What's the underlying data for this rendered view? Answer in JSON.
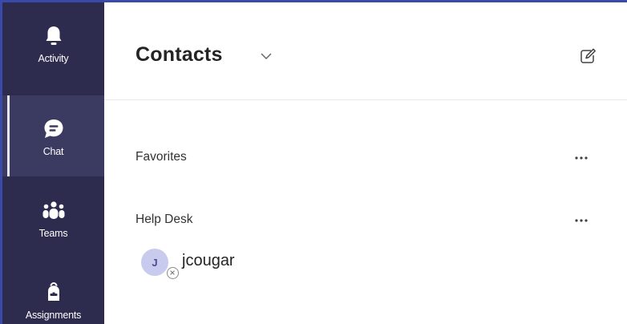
{
  "rail": {
    "items": [
      {
        "label": "Activity",
        "icon": "bell-icon"
      },
      {
        "label": "Chat",
        "icon": "chat-icon"
      },
      {
        "label": "Teams",
        "icon": "teams-icon"
      },
      {
        "label": "Assignments",
        "icon": "backpack-icon"
      }
    ],
    "active": "Chat"
  },
  "header": {
    "title": "Contacts"
  },
  "groups": [
    {
      "label": "Favorites"
    },
    {
      "label": "Help Desk"
    }
  ],
  "contacts": [
    {
      "initial": "J",
      "name": "jcougar",
      "presence_icon": "offline-icon"
    }
  ],
  "colors": {
    "rail_bg": "#2d2c4e",
    "rail_active": "#3b3a60",
    "accent_border": "#3a4aa8",
    "avatar_bg": "#c9cbee"
  }
}
